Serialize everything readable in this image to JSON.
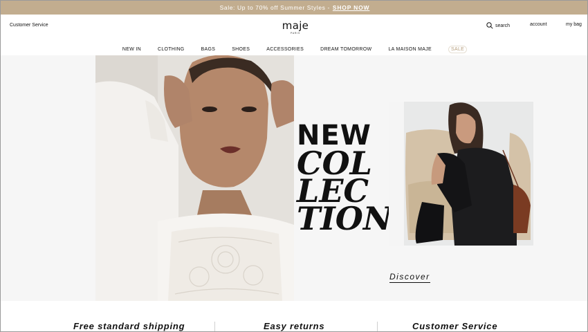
{
  "promo": {
    "text": "Sale: Up to 70% off Summer Styles -",
    "cta": "SHOP NOW"
  },
  "header": {
    "customer_service": "Customer Service",
    "logo": "maje",
    "logo_sub": "PARIS",
    "search_label": "search",
    "account_label": "account",
    "bag_label": "my bag"
  },
  "nav": {
    "items": [
      "NEW IN",
      "CLOTHING",
      "BAGS",
      "SHOES",
      "ACCESSORIES",
      "DREAM TOMORROW",
      "LA MAISON MAJE",
      "SALE"
    ]
  },
  "hero": {
    "line1": "NEW",
    "line2": "COL",
    "line3": "LEC",
    "line4": "TION",
    "cta": "Discover"
  },
  "features": {
    "items": [
      "Free standard shipping",
      "Easy returns",
      "Customer Service"
    ]
  },
  "colors": {
    "promo_bar": "#c2ad8f",
    "sale_accent": "#b49d7c",
    "text": "#111111"
  }
}
